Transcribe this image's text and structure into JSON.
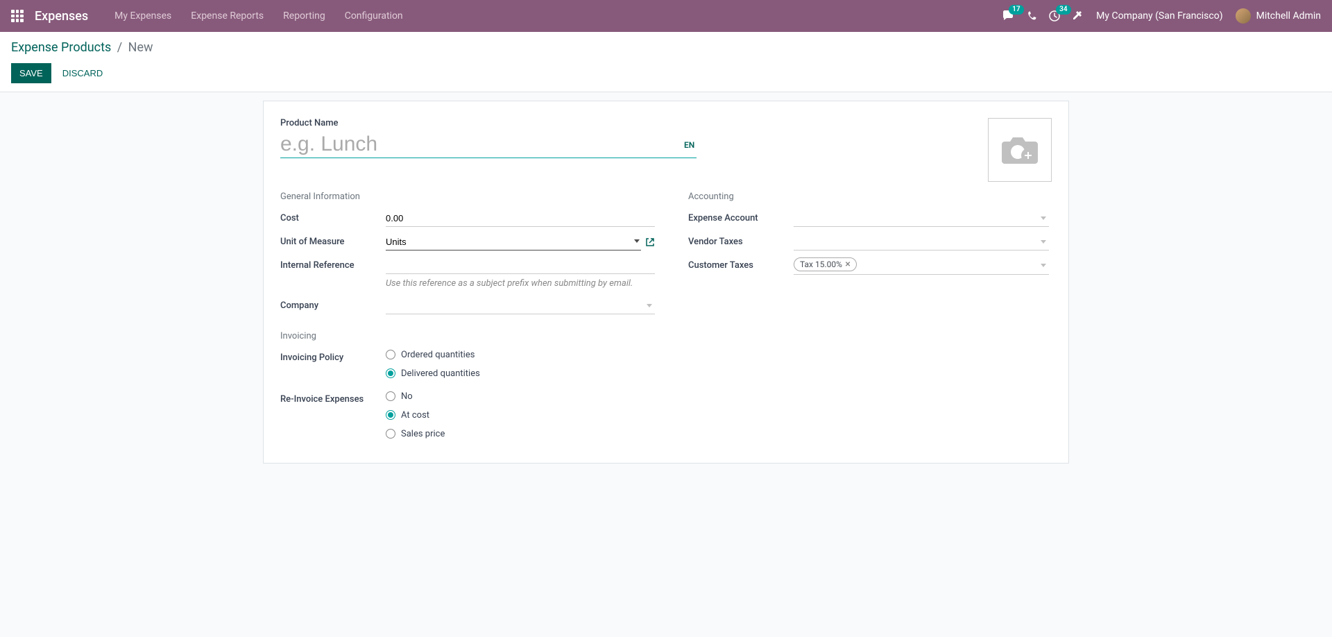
{
  "nav": {
    "brand": "Expenses",
    "items": [
      "My Expenses",
      "Expense Reports",
      "Reporting",
      "Configuration"
    ],
    "messages_badge": "17",
    "activities_badge": "34",
    "company": "My Company (San Francisco)",
    "user": "Mitchell Admin"
  },
  "breadcrumb": {
    "parent": "Expense Products",
    "current": "New"
  },
  "buttons": {
    "save": "SAVE",
    "discard": "DISCARD"
  },
  "form": {
    "product_name_label": "Product Name",
    "product_name_placeholder": "e.g. Lunch",
    "product_name_value": "",
    "lang": "EN",
    "sections": {
      "general": "General Information",
      "invoicing": "Invoicing",
      "accounting": "Accounting"
    },
    "fields": {
      "cost_label": "Cost",
      "cost_value": "0.00",
      "uom_label": "Unit of Measure",
      "uom_value": "Units",
      "ref_label": "Internal Reference",
      "ref_value": "",
      "ref_hint": "Use this reference as a subject prefix when submitting by email.",
      "company_label": "Company",
      "company_value": "",
      "inv_policy_label": "Invoicing Policy",
      "inv_policy_options": [
        "Ordered quantities",
        "Delivered quantities"
      ],
      "inv_policy_selected": "Delivered quantities",
      "reinvoice_label": "Re-Invoice Expenses",
      "reinvoice_options": [
        "No",
        "At cost",
        "Sales price"
      ],
      "reinvoice_selected": "At cost",
      "exp_account_label": "Expense Account",
      "exp_account_value": "",
      "vendor_taxes_label": "Vendor Taxes",
      "customer_taxes_label": "Customer Taxes",
      "customer_taxes_tag": "Tax 15.00%"
    }
  }
}
